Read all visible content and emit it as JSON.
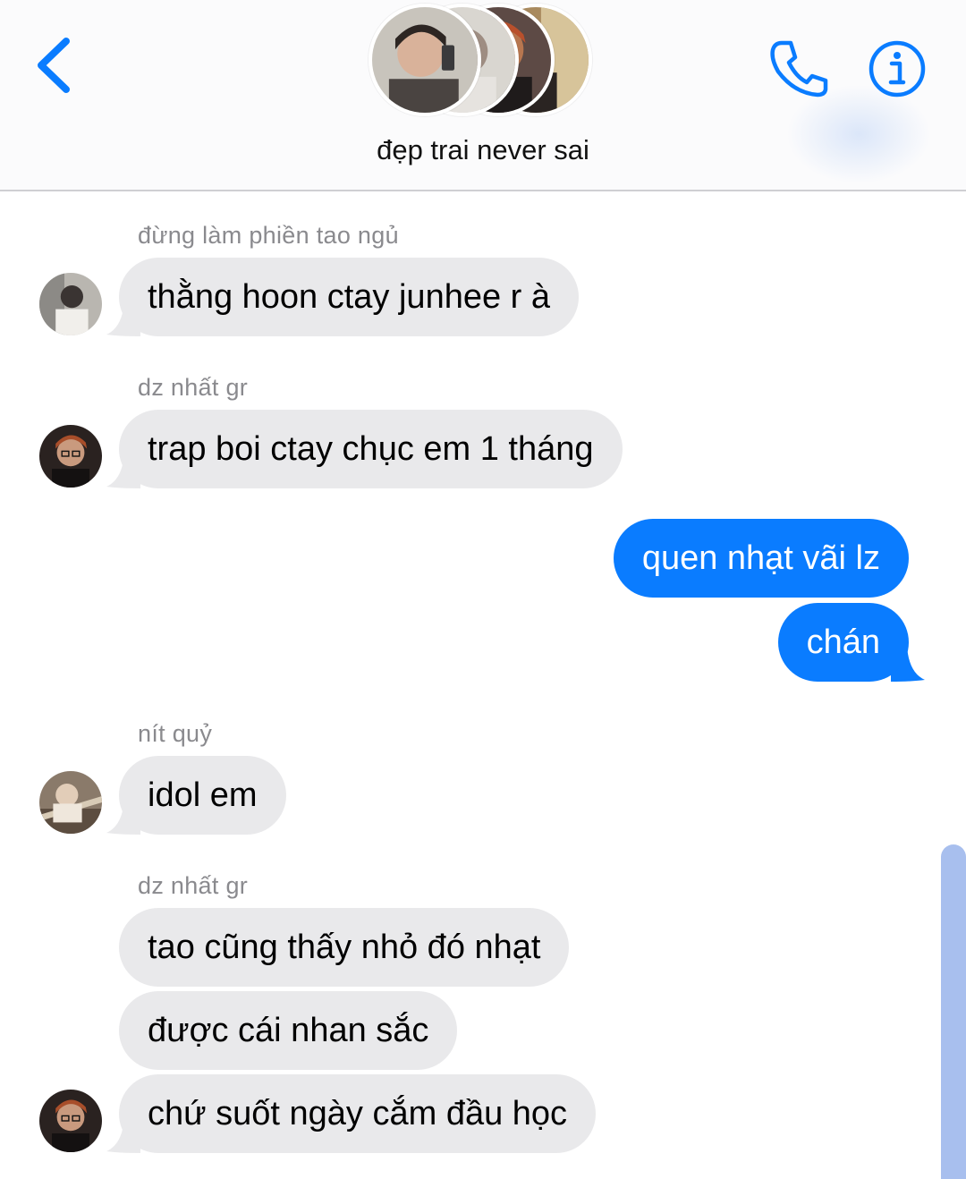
{
  "header": {
    "group_name": "đẹp trai never sai",
    "back_icon": "chevron-left-icon",
    "call_icon": "phone-icon",
    "info_icon": "info-icon",
    "accent_color": "#0a7cff"
  },
  "messages": [
    {
      "sender": "đừng làm phiền tao ngủ",
      "text": "thằng hoon ctay junhee r à",
      "direction": "incoming"
    },
    {
      "sender": "dz nhất gr",
      "text": "trap boi ctay chục em 1 tháng",
      "direction": "incoming"
    },
    {
      "text": "quen nhạt vãi lz",
      "direction": "outgoing"
    },
    {
      "text": "chán",
      "direction": "outgoing"
    },
    {
      "sender": "nít quỷ",
      "text": "idol em",
      "direction": "incoming"
    },
    {
      "sender": "dz nhất gr",
      "text": "tao cũng thấy nhỏ đó nhạt",
      "direction": "incoming"
    },
    {
      "text": "được cái nhan sắc",
      "direction": "incoming"
    },
    {
      "text": "chứ suốt ngày cắm đầu học",
      "direction": "incoming"
    }
  ],
  "colors": {
    "incoming_bubble": "#e9e9eb",
    "outgoing_bubble": "#0a7cff",
    "sender_name": "#8a8a8e"
  }
}
